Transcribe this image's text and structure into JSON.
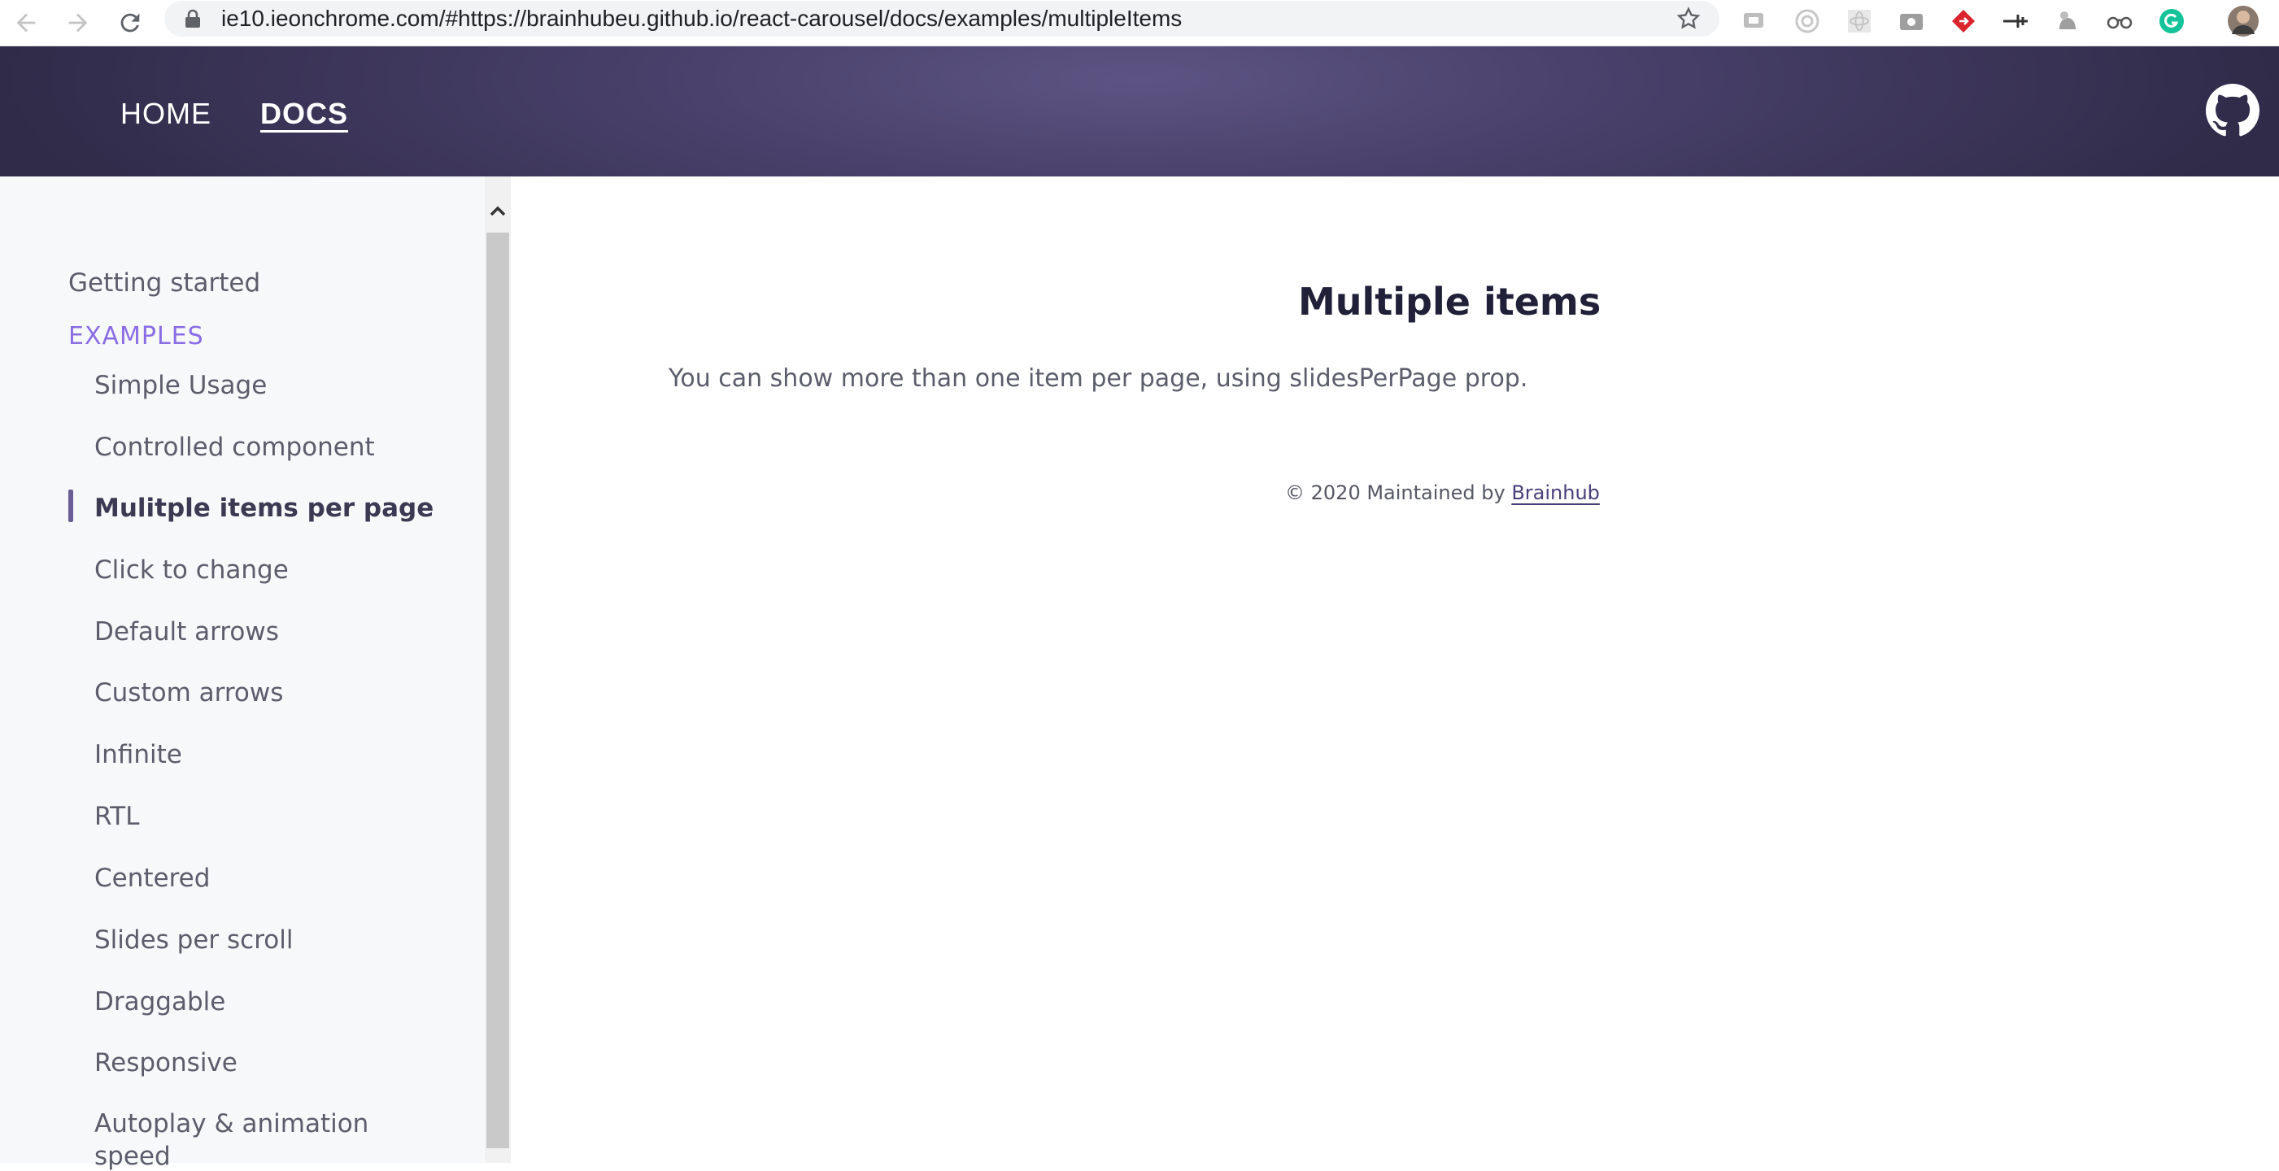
{
  "browser": {
    "url": "ie10.ieonchrome.com/#https://brainhubeu.github.io/react-carousel/docs/examples/multipleItems",
    "icons": [
      "back-icon",
      "forward-icon",
      "reload-icon",
      "lock-icon",
      "bookmark-star-icon"
    ],
    "extensions": [
      "extension-chat-icon",
      "extension-target-icon",
      "extension-react-icon",
      "extension-camera-icon",
      "extension-red-arrow-icon",
      "extension-pin-icon",
      "extension-dog-icon",
      "extension-glasses-icon",
      "extension-grammarly-icon",
      "profile-avatar-icon"
    ]
  },
  "header": {
    "nav": [
      {
        "label": "HOME",
        "active": false
      },
      {
        "label": "DOCS",
        "active": true
      }
    ],
    "github_icon": "github-icon"
  },
  "sidebar": {
    "getting_started": "Getting started",
    "examples_heading": "EXAMPLES",
    "items": [
      {
        "label": "Simple Usage"
      },
      {
        "label": "Controlled component"
      },
      {
        "label": "Mulitple items per page",
        "current": true
      },
      {
        "label": "Click to change"
      },
      {
        "label": "Default arrows"
      },
      {
        "label": "Custom arrows"
      },
      {
        "label": "Infinite"
      },
      {
        "label": "RTL"
      },
      {
        "label": "Centered"
      },
      {
        "label": "Slides per scroll"
      },
      {
        "label": "Draggable"
      },
      {
        "label": "Responsive"
      },
      {
        "label": "Autoplay & animation"
      },
      {
        "label": "speed"
      }
    ]
  },
  "main": {
    "title": "Multiple items",
    "description": "You can show more than one item per page, using slidesPerPage prop.",
    "footer_prefix": "© 2020 Maintained by ",
    "footer_link": "Brainhub"
  },
  "colors": {
    "header_gradient_center": "#5d5483",
    "header_gradient_edge": "#302b49",
    "accent_purple": "#8b6de4",
    "sidebar_bg": "#f7f8fa"
  }
}
